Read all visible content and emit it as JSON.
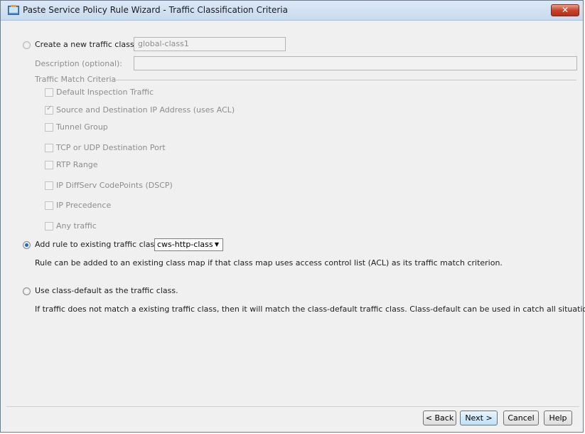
{
  "window": {
    "title": "Paste Service Policy Rule Wizard - Traffic Classification Criteria",
    "close_label": "✕"
  },
  "create_new": {
    "label": "Create a new traffic class:",
    "value": "global-class1",
    "description_label": "Description (optional):",
    "description_value": ""
  },
  "match_criteria": {
    "legend": "Traffic Match Criteria",
    "items": [
      {
        "label": "Default Inspection Traffic",
        "checked": false
      },
      {
        "label": "Source and Destination IP Address (uses ACL)",
        "checked": true
      },
      {
        "label": "Tunnel Group",
        "checked": false
      },
      {
        "label": "TCP or UDP Destination Port",
        "checked": false
      },
      {
        "label": "RTP Range",
        "checked": false
      },
      {
        "label": "IP DiffServ CodePoints (DSCP)",
        "checked": false
      },
      {
        "label": "IP Precedence",
        "checked": false
      },
      {
        "label": "Any traffic",
        "checked": false
      }
    ]
  },
  "existing": {
    "label": "Add rule to existing traffic class:",
    "selected": "cws-http-class",
    "note": "Rule can be added to an existing class map if that class map uses access control list (ACL) as its traffic match criterion."
  },
  "class_default": {
    "label": "Use class-default as the traffic class.",
    "note": "If traffic does not match a existing traffic class, then it will match the class-default traffic class. Class-default can be used in catch all situation."
  },
  "buttons": {
    "back": "< Back",
    "next": "Next >",
    "cancel": "Cancel",
    "help": "Help"
  }
}
